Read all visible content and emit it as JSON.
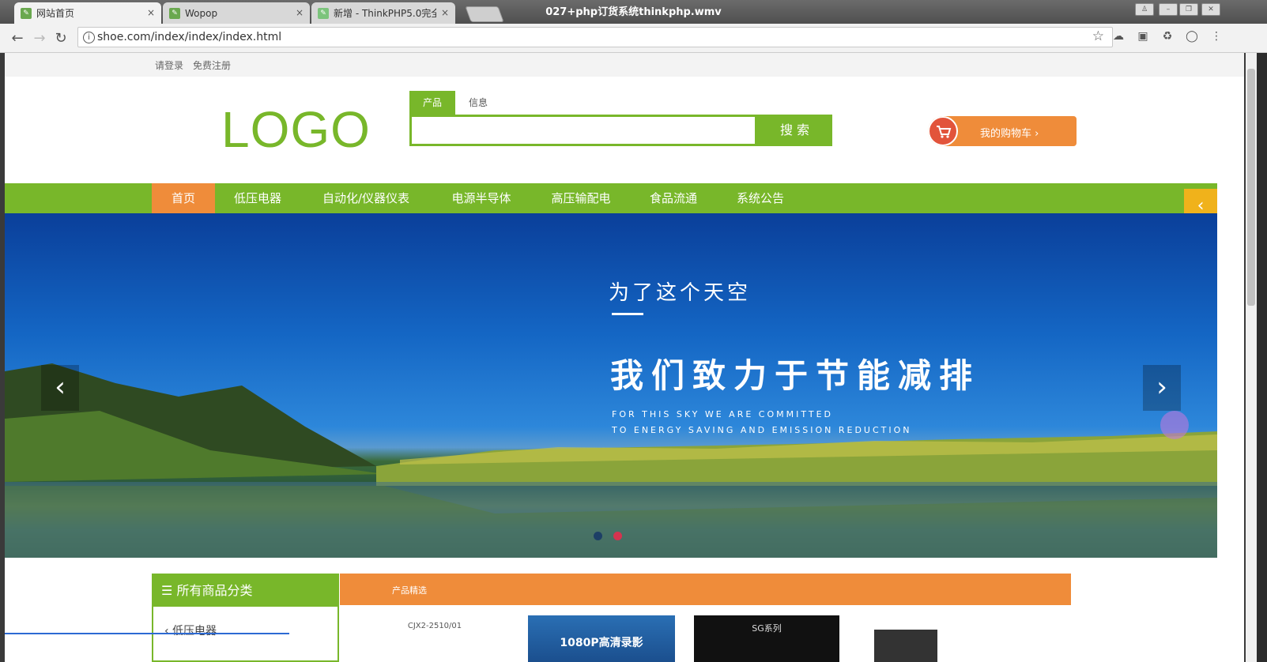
{
  "window": {
    "title": "027+php订货系统thinkphp.wmv"
  },
  "tabs": [
    {
      "label": "网站首页",
      "close": "×"
    },
    {
      "label": "Wopop",
      "close": "×"
    },
    {
      "label": "新增 - ThinkPHP5.0完全",
      "close": "×"
    }
  ],
  "browser": {
    "url": "shoe.com/index/index/index.html"
  },
  "page": {
    "topbar": {
      "login": "请登录",
      "register": "免费注册"
    },
    "logo": "LOGO",
    "search": {
      "tab_product": "产品",
      "tab_info": "信息",
      "button": "搜 索"
    },
    "cart": {
      "label": "我的购物车 ›"
    },
    "nav": [
      "首页",
      "低压电器",
      "自动化/仪器仪表",
      "电源半导体",
      "高压输配电",
      "食品流通",
      "系统公告"
    ],
    "banner": {
      "heading_small": "为了这个天空",
      "heading_large": "我们致力于节能减排",
      "subtitle_line1": "FOR THIS SKY  WE ARE COMMITTED",
      "subtitle_line2": "TO ENERGY SAVING AND EMISSION REDUCTION"
    },
    "categories": {
      "title": "所有商品分类",
      "first_item": "低压电器"
    },
    "products": {
      "title": "产品精选",
      "thumb1_text": "CJX2-2510/01",
      "thumb2_text": "1080P高清录影",
      "thumb3_text": "SG系列"
    }
  }
}
